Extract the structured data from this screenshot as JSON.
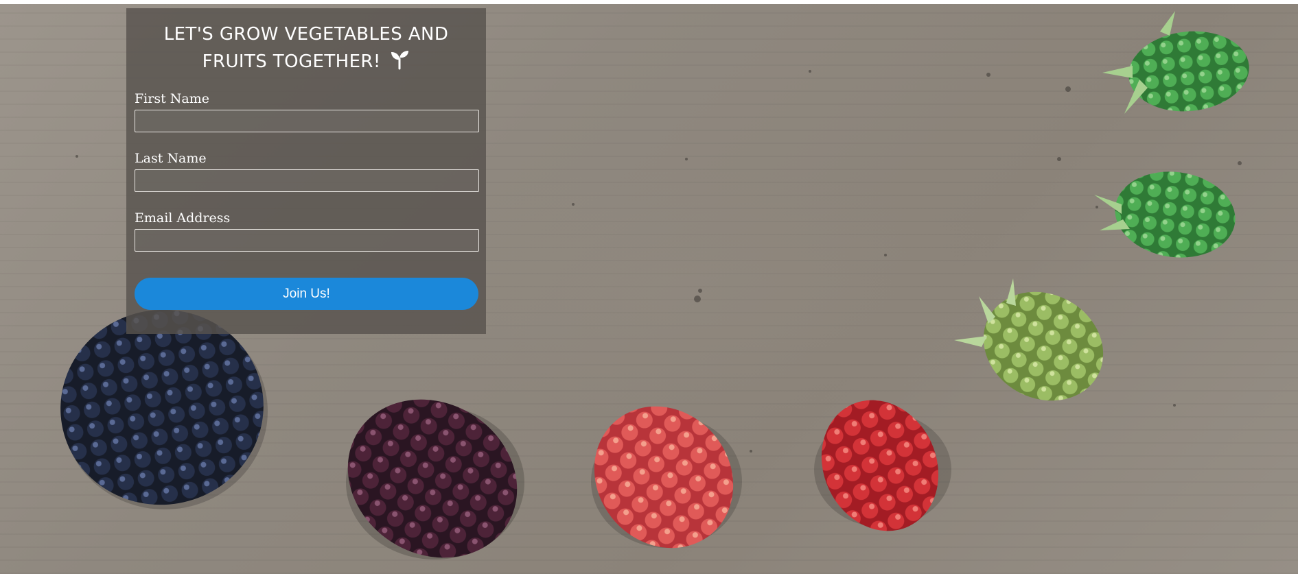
{
  "signup": {
    "title_line1": "LET'S GROW VEGETABLES AND",
    "title_line2": "FRUITS TOGETHER!",
    "title_icon": "sprout-icon",
    "fields": [
      {
        "label": "First Name",
        "value": ""
      },
      {
        "label": "Last Name",
        "value": ""
      },
      {
        "label": "Email Address",
        "value": ""
      }
    ],
    "submit_label": "Join Us!"
  },
  "colors": {
    "button": "#1b88da",
    "panel": "#58534e",
    "background": "#918a81"
  },
  "background_image": {
    "subject": "berries-ripening-stages-on-concrete",
    "berries": [
      {
        "name": "ripe-black-berry",
        "color": "#1e2536"
      },
      {
        "name": "dark-purple-berry",
        "color": "#4a2236"
      },
      {
        "name": "red-pink-berry",
        "color": "#d9474a"
      },
      {
        "name": "red-berry",
        "color": "#c8282e"
      },
      {
        "name": "green-yellow-berry",
        "color": "#8fb35b"
      },
      {
        "name": "green-berry",
        "color": "#4ea54e"
      },
      {
        "name": "small-green-berry",
        "color": "#3f9a49"
      }
    ]
  }
}
